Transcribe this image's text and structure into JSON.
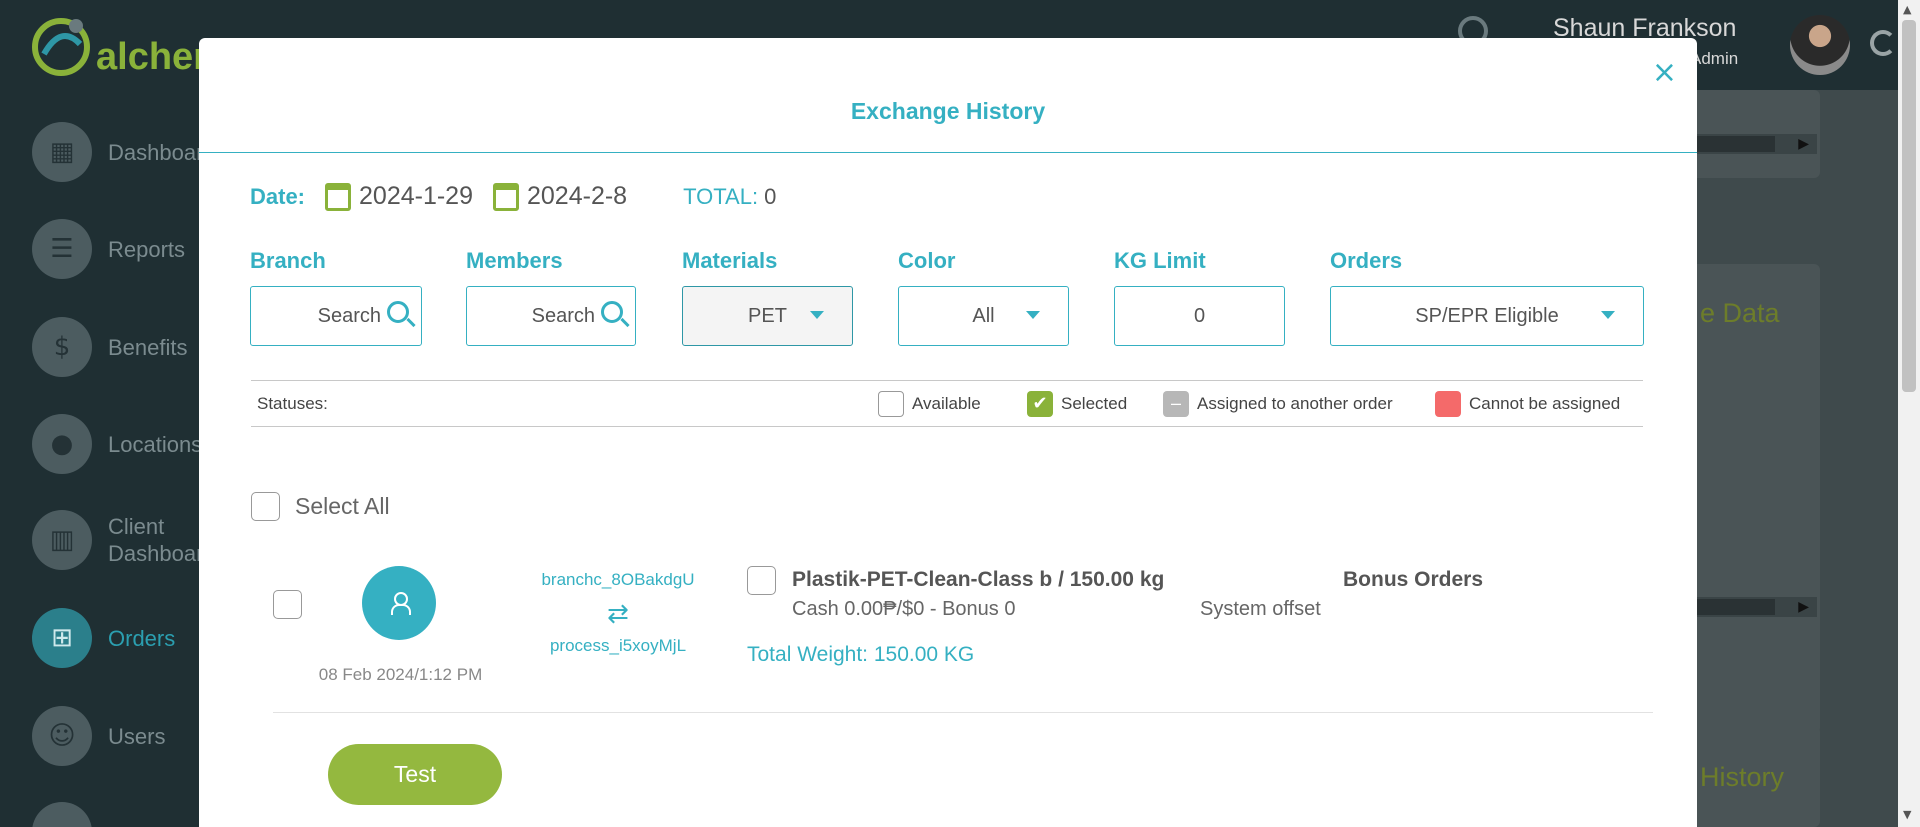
{
  "app": {
    "logo_text": "alcher",
    "user_name": "Shaun Frankson",
    "user_role": "Admin"
  },
  "sidebar": {
    "items": [
      {
        "label": "Dashboard",
        "icon": "dashboard-icon"
      },
      {
        "label": "Reports",
        "icon": "list-icon"
      },
      {
        "label": "Benefits",
        "icon": "dollar-icon"
      },
      {
        "label": "Locations",
        "icon": "location-pin-icon"
      },
      {
        "label": "Client Dashboard",
        "icon": "bar-chart-icon"
      },
      {
        "label": "Orders",
        "icon": "add-box-icon",
        "active": true
      },
      {
        "label": "Users",
        "icon": "users-icon"
      }
    ]
  },
  "background": {
    "card_text_1": "e Data",
    "card_text_2": "History"
  },
  "modal": {
    "title": "Exchange History",
    "close_label": "×",
    "date_label": "Date:",
    "date_from": "2024-1-29",
    "date_to": "2024-2-8",
    "total_label": "TOTAL:",
    "total_value": "0",
    "filters": {
      "branch": {
        "label": "Branch",
        "placeholder": "Search"
      },
      "members": {
        "label": "Members",
        "placeholder": "Search"
      },
      "materials": {
        "label": "Materials",
        "value": "PET"
      },
      "color": {
        "label": "Color",
        "value": "All"
      },
      "kg_limit": {
        "label": "KG Limit",
        "value": "0"
      },
      "orders": {
        "label": "Orders",
        "value": "SP/EPR Eligible"
      }
    },
    "statuses": {
      "label": "Statuses:",
      "available": "Available",
      "selected": "Selected",
      "assigned": "Assigned to another order",
      "cannot": "Cannot be assigned"
    },
    "select_all": "Select All",
    "order": {
      "date": "08 Feb 2024/1:12 PM",
      "branch_from": "branchc_8OBakdgU",
      "branch_to": "process_i5xoyMjL",
      "item_title": "Plastik-PET-Clean-Class b / 150.00 kg",
      "item_sub": "Cash 0.00₱/$0 - Bonus 0",
      "total_weight": "Total Weight: 150.00 KG",
      "bonus_header": "Bonus Orders",
      "bonus_value": "System offset"
    },
    "test_button": "Test"
  },
  "colors": {
    "accent": "#35b0c2",
    "green": "#8ab23a",
    "danger": "#f46a6a"
  }
}
